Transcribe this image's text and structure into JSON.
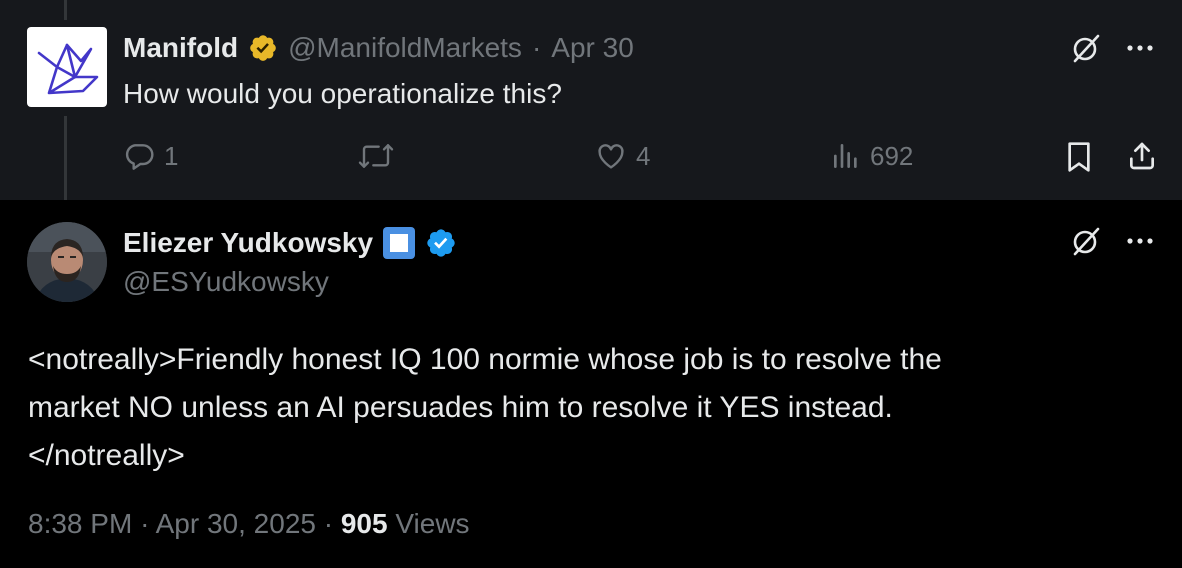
{
  "parent": {
    "name": "Manifold",
    "handle": "@ManifoldMarkets",
    "separator": "·",
    "date": "Apr 30",
    "text": "How would you operationalize this?",
    "actions": {
      "replies": "1",
      "reposts": "",
      "likes": "4",
      "views": "692"
    }
  },
  "main": {
    "name": "Eliezer Yudkowsky",
    "handle": "@ESYudkowsky",
    "text_lines": [
      "<notreally>Friendly honest IQ 100 normie whose job is to resolve the",
      "market NO unless an AI persuades him to resolve it YES instead.",
      "</notreally>"
    ],
    "time": "8:38 PM",
    "separator": "·",
    "date": "Apr 30, 2025",
    "views_count": "905",
    "views_label": "Views"
  },
  "colors": {
    "background": "#000000",
    "parent_background": "#16181c",
    "text": "#e7e9ea",
    "muted": "#71767b",
    "verified_blue": "#1d9bf0",
    "verified_gold": "#e8b829"
  },
  "icons": {
    "grok": "grok-icon",
    "more": "more-icon",
    "reply": "reply-icon",
    "repost": "repost-icon",
    "like": "like-icon",
    "views": "views-icon",
    "bookmark": "bookmark-icon",
    "share": "share-icon"
  }
}
